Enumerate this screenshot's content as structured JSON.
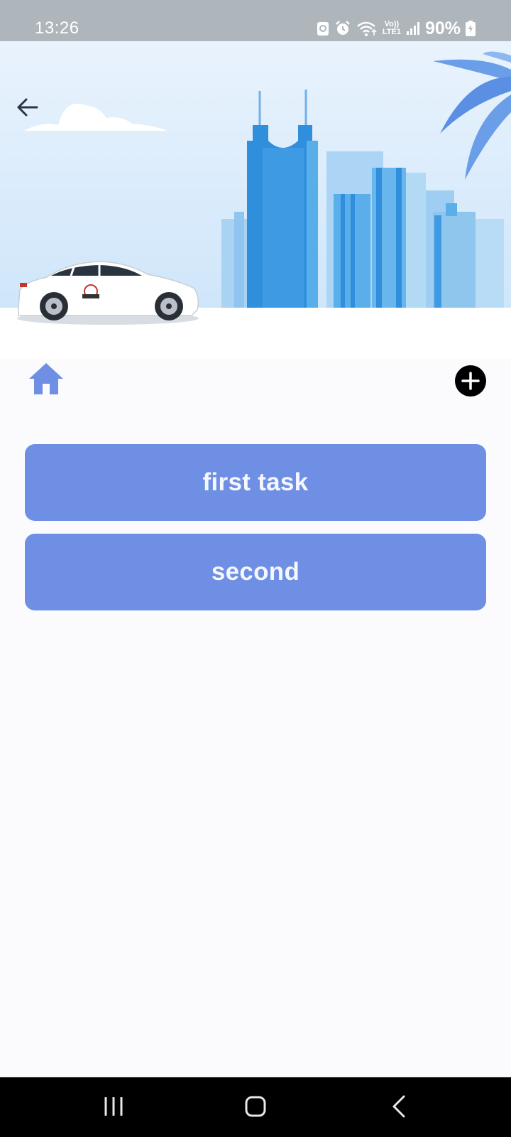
{
  "status_bar": {
    "time": "13:26",
    "volte_label": "Vo))",
    "lte_label": "LTE1",
    "battery": "90%"
  },
  "tasks": [
    {
      "title": "first task"
    },
    {
      "title": "second"
    }
  ],
  "colors": {
    "accent": "#6e8fe3",
    "status_bar_bg": "#aeb5bb",
    "page_bg": "#fbfbfe",
    "sky": "#e6f2fc",
    "buildings": "#2f8fdc"
  },
  "icons": {
    "back": "arrow-left-icon",
    "home": "home-icon",
    "add": "plus-circle-icon",
    "nav_recents": "recents-icon",
    "nav_home": "nav-home-icon",
    "nav_back": "nav-back-icon"
  }
}
